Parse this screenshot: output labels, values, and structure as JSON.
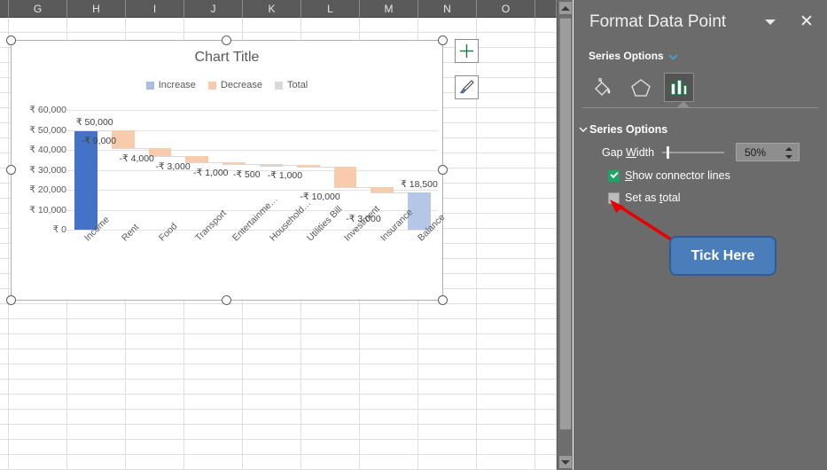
{
  "spreadsheet": {
    "column_headers": [
      "G",
      "H",
      "I",
      "J",
      "K",
      "L",
      "M",
      "N",
      "O"
    ],
    "scrollbar": {
      "up_arrow": "scroll-up",
      "down_arrow": "scroll-down"
    }
  },
  "chart": {
    "title": "Chart Title",
    "element_buttons": [
      {
        "name": "chart-elements-button",
        "glyph": "+"
      },
      {
        "name": "chart-styles-button",
        "glyph": "brush"
      }
    ],
    "legend": [
      {
        "label": "Increase",
        "color": "#A9BEDF"
      },
      {
        "label": "Decrease",
        "color": "#F8CBAD"
      },
      {
        "label": "Total",
        "color": "#D9D9D9"
      }
    ]
  },
  "chart_data": {
    "type": "bar",
    "subtype": "waterfall",
    "title": "Chart Title",
    "xlabel": "",
    "ylabel": "",
    "ylim": [
      0,
      60000
    ],
    "ytick_labels": [
      "₹ 0",
      "₹ 10,000",
      "₹ 20,000",
      "₹ 30,000",
      "₹ 40,000",
      "₹ 50,000",
      "₹ 60,000"
    ],
    "ytick_values": [
      0,
      10000,
      20000,
      30000,
      40000,
      50000,
      60000
    ],
    "grid": true,
    "legend_position": "top",
    "categories": [
      "Income",
      "Rent",
      "Food",
      "Transport",
      "Entertainme…",
      "Household…",
      "Utilities Bill",
      "Investment",
      "Insurance",
      "Balance"
    ],
    "values": [
      50000,
      -9000,
      -4000,
      -3000,
      -1000,
      -500,
      -1000,
      -10000,
      -3000,
      18500
    ],
    "data_labels": [
      "₹ 50,000",
      "-₹ 9,000",
      "-₹ 4,000",
      "-₹ 3,000",
      "-₹ 1,000",
      "-₹ 500",
      "-₹ 1,000",
      "-₹ 10,000",
      "-₹ 3,000",
      "₹ 18,500"
    ],
    "bar_types": [
      "increase",
      "decrease",
      "decrease",
      "decrease",
      "decrease",
      "decrease",
      "decrease",
      "decrease",
      "decrease",
      "total"
    ],
    "cumulative_start": [
      0,
      50000,
      41000,
      37000,
      34000,
      33000,
      32500,
      31500,
      21500,
      0
    ],
    "cumulative_end": [
      50000,
      41000,
      37000,
      34000,
      33000,
      32500,
      31500,
      21500,
      18500,
      18500
    ],
    "colors": {
      "selected_increase": "#4472C4",
      "increase": "#A9BEDF",
      "decrease": "#F8CBAD",
      "total": "#B4C7E7"
    }
  },
  "pane": {
    "title": "Format Data Point",
    "dropdown_icon": "chevron-down-icon",
    "close_icon": "close-icon",
    "series_options_link": "Series Options",
    "tabs": [
      {
        "name": "fill-line-tab",
        "icon": "paint-bucket-icon",
        "selected": false
      },
      {
        "name": "effects-tab",
        "icon": "pentagon-icon",
        "selected": false
      },
      {
        "name": "series-options-tab",
        "icon": "bar-chart-icon",
        "selected": true
      }
    ],
    "section_title": "Series Options",
    "gap_width": {
      "label": "Gap Width",
      "label_pre": "Gap ",
      "label_key": "W",
      "label_post": "idth",
      "value": "50%"
    },
    "show_connector_lines": {
      "label": "Show connector lines",
      "label_key": "S",
      "label_post": "how connector lines",
      "checked": true
    },
    "set_as_total": {
      "label": "Set as total",
      "label_pre": "Set as ",
      "label_key": "t",
      "label_post": "otal",
      "checked": false
    }
  },
  "annotation": {
    "callout_text": "Tick Here",
    "arrow": "red-arrow",
    "callout_color": "#4A7EBB"
  }
}
